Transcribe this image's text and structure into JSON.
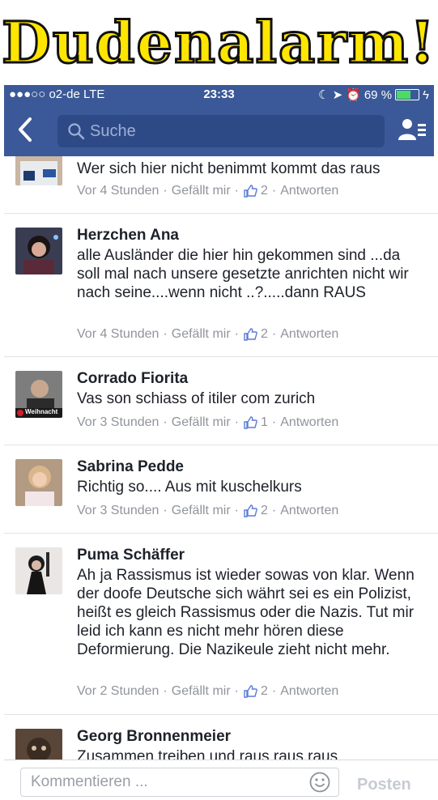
{
  "banner": {
    "title": "Dudenalarm!"
  },
  "statusbar": {
    "carrier": "●●●○○ o2-de  LTE",
    "time": "23:33",
    "battery": "69 %",
    "battery_level": 0.69
  },
  "navbar": {
    "search_placeholder": "Suche"
  },
  "comments": [
    {
      "name": "",
      "text": "Wer sich hier nicht benimmt kommt das raus",
      "time": "Vor 4 Stunden",
      "like": "Gefällt mir",
      "count": "2",
      "reply": "Antworten"
    },
    {
      "name": "Herzchen Ana",
      "text": "alle Ausländer die hier hin gekommen sind ...da soll mal nach unsere gesetzte anrichten nicht wir nach seine....wenn nicht ..?.....dann  RAUS",
      "time": "Vor 4 Stunden",
      "like": "Gefällt mir",
      "count": "2",
      "reply": "Antworten"
    },
    {
      "name": "Corrado Fiorita",
      "text": "Vas son schiass of itiler com zurich",
      "time": "Vor 3 Stunden",
      "like": "Gefällt mir",
      "count": "1",
      "reply": "Antworten",
      "avatar_label": "Weihnacht"
    },
    {
      "name": "Sabrina Pedde",
      "text": "Richtig so.... Aus mit kuschelkurs",
      "time": "Vor 3 Stunden",
      "like": "Gefällt mir",
      "count": "2",
      "reply": "Antworten"
    },
    {
      "name": "Puma Schäffer",
      "text": "Ah ja Rassismus ist wieder sowas von klar. Wenn der doofe Deutsche sich währt sei es ein Polizist, heißt es gleich Rassismus oder die Nazis. Tut mir leid ich kann es nicht mehr hören diese Deformierung. Die Nazikeule zieht nicht mehr.",
      "time": "Vor 2 Stunden",
      "like": "Gefällt mir",
      "count": "2",
      "reply": "Antworten"
    },
    {
      "name": "Georg Bronnenmeier",
      "text": "Zusammen treiben und raus raus raus"
    }
  ],
  "composer": {
    "placeholder": "Kommentieren ...",
    "post_label": "Posten"
  },
  "colors": {
    "facebook_blue": "#3b5998",
    "banner_yellow": "#ffe600",
    "meta_gray": "#90949c"
  }
}
